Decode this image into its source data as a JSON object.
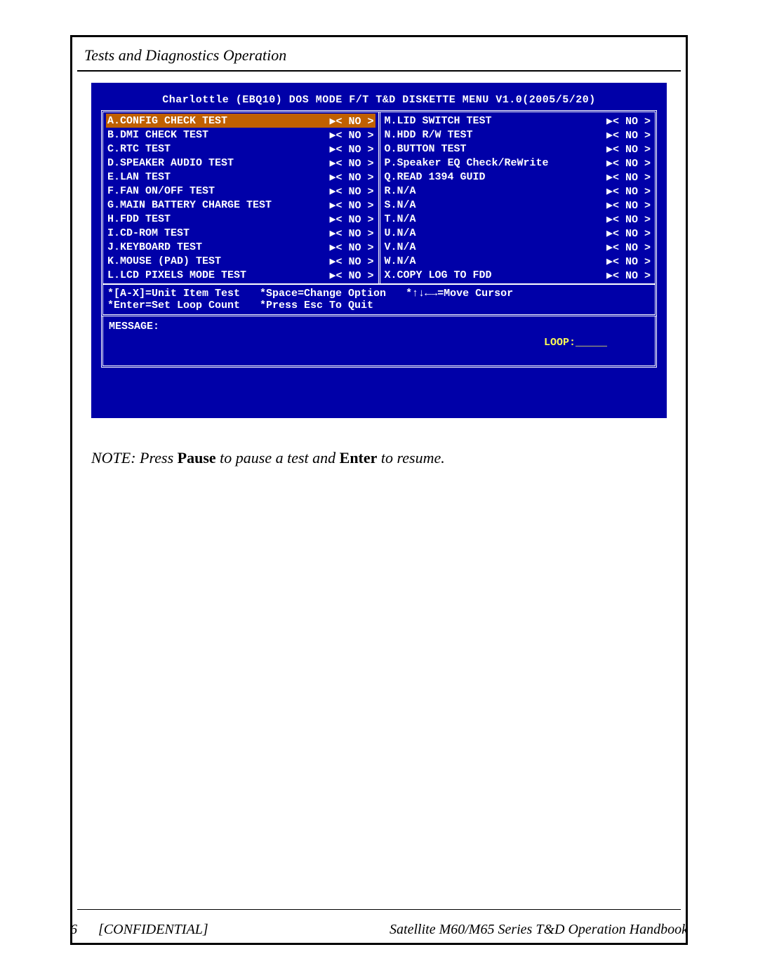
{
  "header": {
    "section_title": "Tests and Diagnostics Operation"
  },
  "dos": {
    "title": "Charlottle (EBQ10) DOS MODE F/T T&D DISKETTE MENU V1.0(2005/5/20)",
    "option_marker_left": "▶<",
    "option_marker_right": ">",
    "left_items": [
      {
        "label": "A.CONFIG CHECK TEST",
        "opt": "NO",
        "selected": true
      },
      {
        "label": "B.DMI CHECK TEST",
        "opt": "NO"
      },
      {
        "label": "C.RTC TEST",
        "opt": "NO"
      },
      {
        "label": "D.SPEAKER AUDIO TEST",
        "opt": "NO"
      },
      {
        "label": "E.LAN TEST",
        "opt": "NO"
      },
      {
        "label": "F.FAN ON/OFF TEST",
        "opt": "NO"
      },
      {
        "label": "G.MAIN BATTERY CHARGE TEST",
        "opt": "NO"
      },
      {
        "label": "H.FDD TEST",
        "opt": "NO"
      },
      {
        "label": "I.CD-ROM TEST",
        "opt": "NO"
      },
      {
        "label": "J.KEYBOARD TEST",
        "opt": "NO"
      },
      {
        "label": "K.MOUSE (PAD) TEST",
        "opt": "NO"
      },
      {
        "label": "L.LCD PIXELS MODE TEST",
        "opt": "NO"
      }
    ],
    "right_items": [
      {
        "label": "M.LID SWITCH TEST",
        "opt": "NO"
      },
      {
        "label": "N.HDD R/W TEST",
        "opt": "NO"
      },
      {
        "label": "O.BUTTON TEST",
        "opt": "NO"
      },
      {
        "label": "P.Speaker EQ Check/ReWrite",
        "opt": "NO"
      },
      {
        "label": "Q.READ 1394 GUID",
        "opt": "NO"
      },
      {
        "label": "R.N/A",
        "opt": "NO"
      },
      {
        "label": "S.N/A",
        "opt": "NO"
      },
      {
        "label": "T.N/A",
        "opt": "NO"
      },
      {
        "label": "U.N/A",
        "opt": "NO"
      },
      {
        "label": "V.N/A",
        "opt": "NO"
      },
      {
        "label": "W.N/A",
        "opt": "NO"
      },
      {
        "label": "X.COPY LOG TO FDD",
        "opt": "NO"
      }
    ],
    "hints": [
      "*[A-X]=Unit Item Test",
      "*Space=Change Option",
      "*↑↓←→=Move Cursor",
      "*Enter=Set Loop Count",
      "*Press Esc To Quit"
    ],
    "message_label": "MESSAGE:",
    "loop_label": "LOOP:_____"
  },
  "note": {
    "prefix": "NOTE:  Press ",
    "kw1": "Pause",
    "mid": " to pause a test and ",
    "kw2": "Enter",
    "suffix": " to resume."
  },
  "footer": {
    "page_number": "6",
    "confidential": "[CONFIDENTIAL]",
    "handbook_title": "Satellite M60/M65 Series T&D Operation Handbook"
  }
}
